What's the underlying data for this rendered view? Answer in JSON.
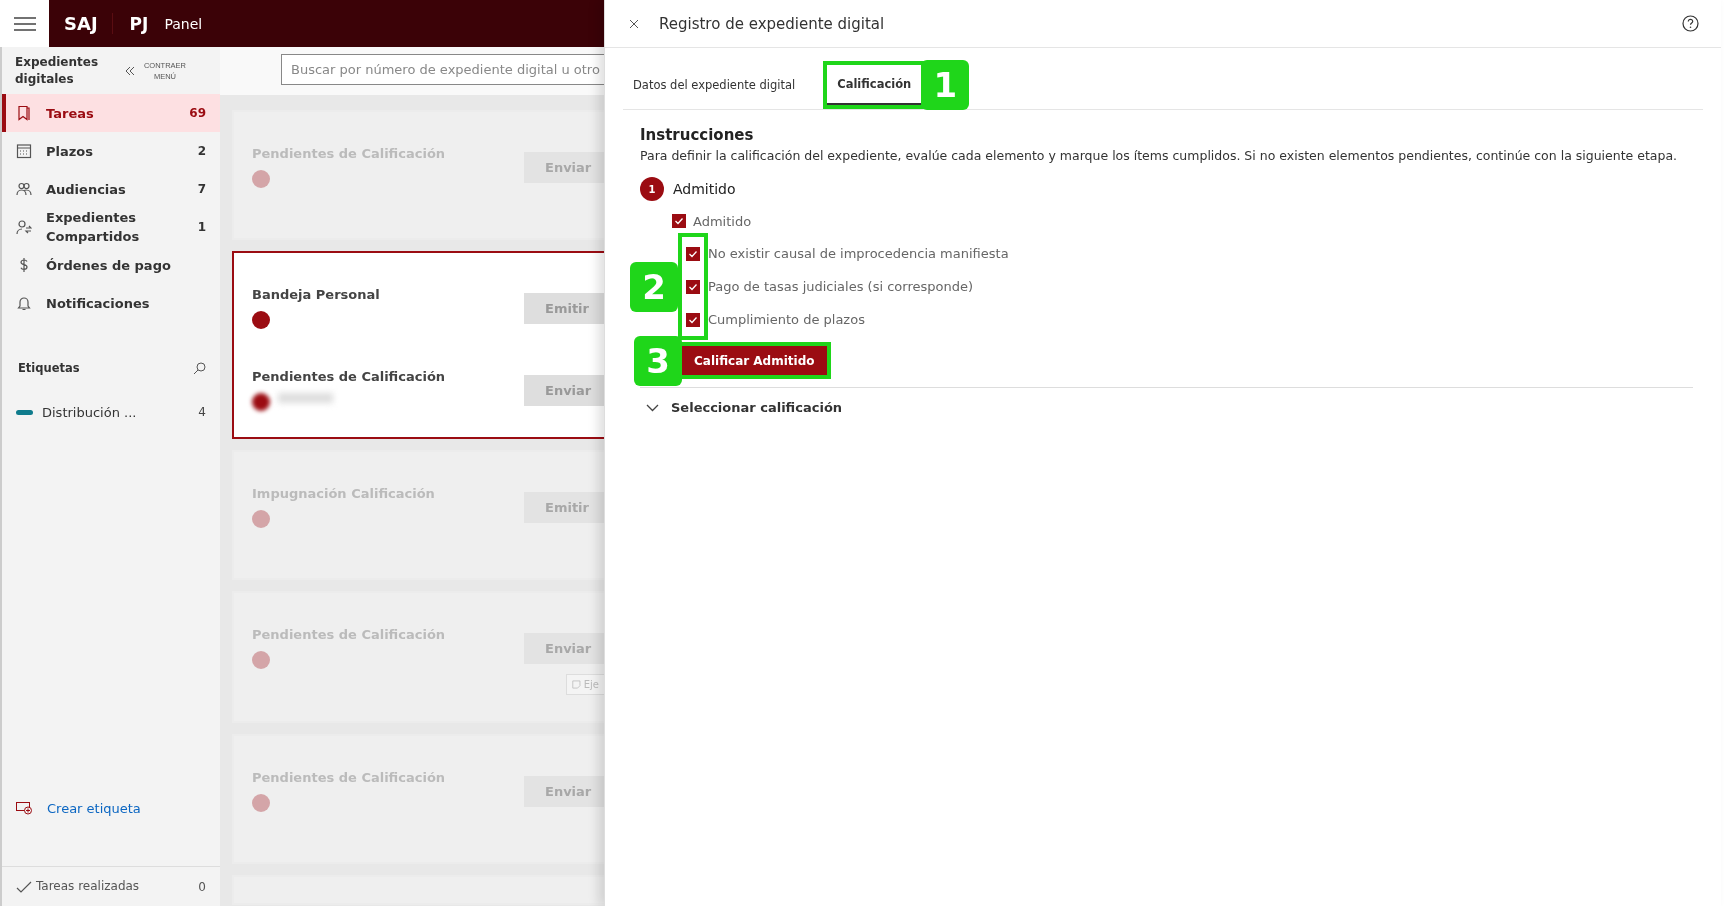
{
  "app_bar": {
    "logo": "SAJ",
    "brand": "PJ",
    "title": "Panel"
  },
  "sidebar": {
    "heading": "Expedientes digitales",
    "collapse": "CONTRAER MENÚ",
    "items": [
      {
        "label": "Tareas",
        "count": "69",
        "selected": true
      },
      {
        "label": "Plazos",
        "count": "2",
        "selected": false
      },
      {
        "label": "Audiencias",
        "count": "7",
        "selected": false
      },
      {
        "label": "Expedientes Compartidos",
        "count": "1",
        "selected": false
      },
      {
        "label": "Órdenes de pago",
        "selected": false
      },
      {
        "label": "Notificaciones",
        "selected": false
      }
    ],
    "tags_heading": "Etiquetas",
    "tags": [
      {
        "label": "Distribución ...",
        "count": "4",
        "color": "#0f7b8c"
      }
    ],
    "create_tag": "Crear etiqueta",
    "done": {
      "label": "Tareas realizadas",
      "count": "0"
    }
  },
  "search": {
    "placeholder": "Buscar por número de expediente digital u otro"
  },
  "cards": [
    {
      "selected": false,
      "sections": [
        {
          "title": "Pendientes de Calificación",
          "action": "Enviar"
        }
      ]
    },
    {
      "selected": true,
      "sections": [
        {
          "title": "Bandeja Personal",
          "action": "Emitir"
        },
        {
          "title": "Pendientes de Calificación",
          "action": "Enviar",
          "blurred": true
        }
      ]
    },
    {
      "selected": false,
      "sections": [
        {
          "title": "Impugnación Calificación",
          "action": "Emitir"
        }
      ]
    },
    {
      "selected": false,
      "sections": [
        {
          "title": "Pendientes de Calificación",
          "action": "Enviar",
          "secondary": "Eje"
        }
      ]
    },
    {
      "selected": false,
      "sections": [
        {
          "title": "Pendientes de Calificación",
          "action": "Enviar"
        }
      ]
    },
    {
      "selected": false
    }
  ],
  "panel": {
    "title": "Registro de expediente digital",
    "tabs": [
      {
        "label": "Datos del expediente digital",
        "selected": false
      },
      {
        "label": "Calificación",
        "selected": true,
        "callout": "1"
      }
    ],
    "instructions_title": "Instrucciones",
    "instructions": "Para definir la calificación del expediente, evalúe cada elemento y marque los ítems cumplidos. Si no existen elementos pendientes, continúe con la siguiente etapa.",
    "step": {
      "number": "1",
      "label": "Admitido"
    },
    "main_check": {
      "label": "Admitido",
      "checked": true
    },
    "checks_callout": "2",
    "checks": [
      {
        "label": "No existir causal de improcedencia manifiesta",
        "checked": true
      },
      {
        "label": "Pago de tasas judiciales (si corresponde)",
        "checked": true
      },
      {
        "label": "Cumplimiento de plazos",
        "checked": true
      }
    ],
    "button": {
      "label": "Calificar Admitido",
      "callout": "3"
    },
    "accordion": {
      "label": "Seleccionar calificación",
      "expanded": false
    }
  }
}
